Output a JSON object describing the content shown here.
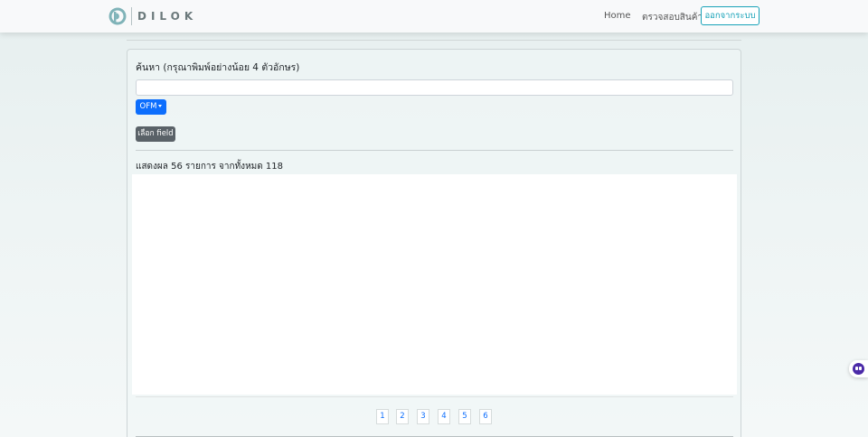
{
  "header": {
    "brand_text": "DILOK",
    "nav": {
      "home_label": "Home",
      "check_product_label": "ตรวจสอบสินค้า",
      "logout_label": "ออกจากระบบ"
    }
  },
  "search": {
    "title": "ค้นหา (กรุณาพิมพ์อย่างน้อย 4 ตัวอักษร)",
    "input_value": "",
    "input_placeholder": "",
    "filter_label": "OFM",
    "select_field_label": "เลือก field"
  },
  "results": {
    "summary_text": "แสดงผล 56 รายการ จากทั้งหมด 118"
  },
  "pagination": {
    "pages": [
      "1",
      "2",
      "3",
      "4",
      "5",
      "6"
    ]
  },
  "colors": {
    "primary": "#0d6efd",
    "info": "#17a2b8",
    "secondary": "#5a6268",
    "widget": "#4b2aa8"
  },
  "icons": {
    "logo": "dilok-logo-icon",
    "caret": "caret-down-icon",
    "widget": "assistant-face-icon"
  }
}
